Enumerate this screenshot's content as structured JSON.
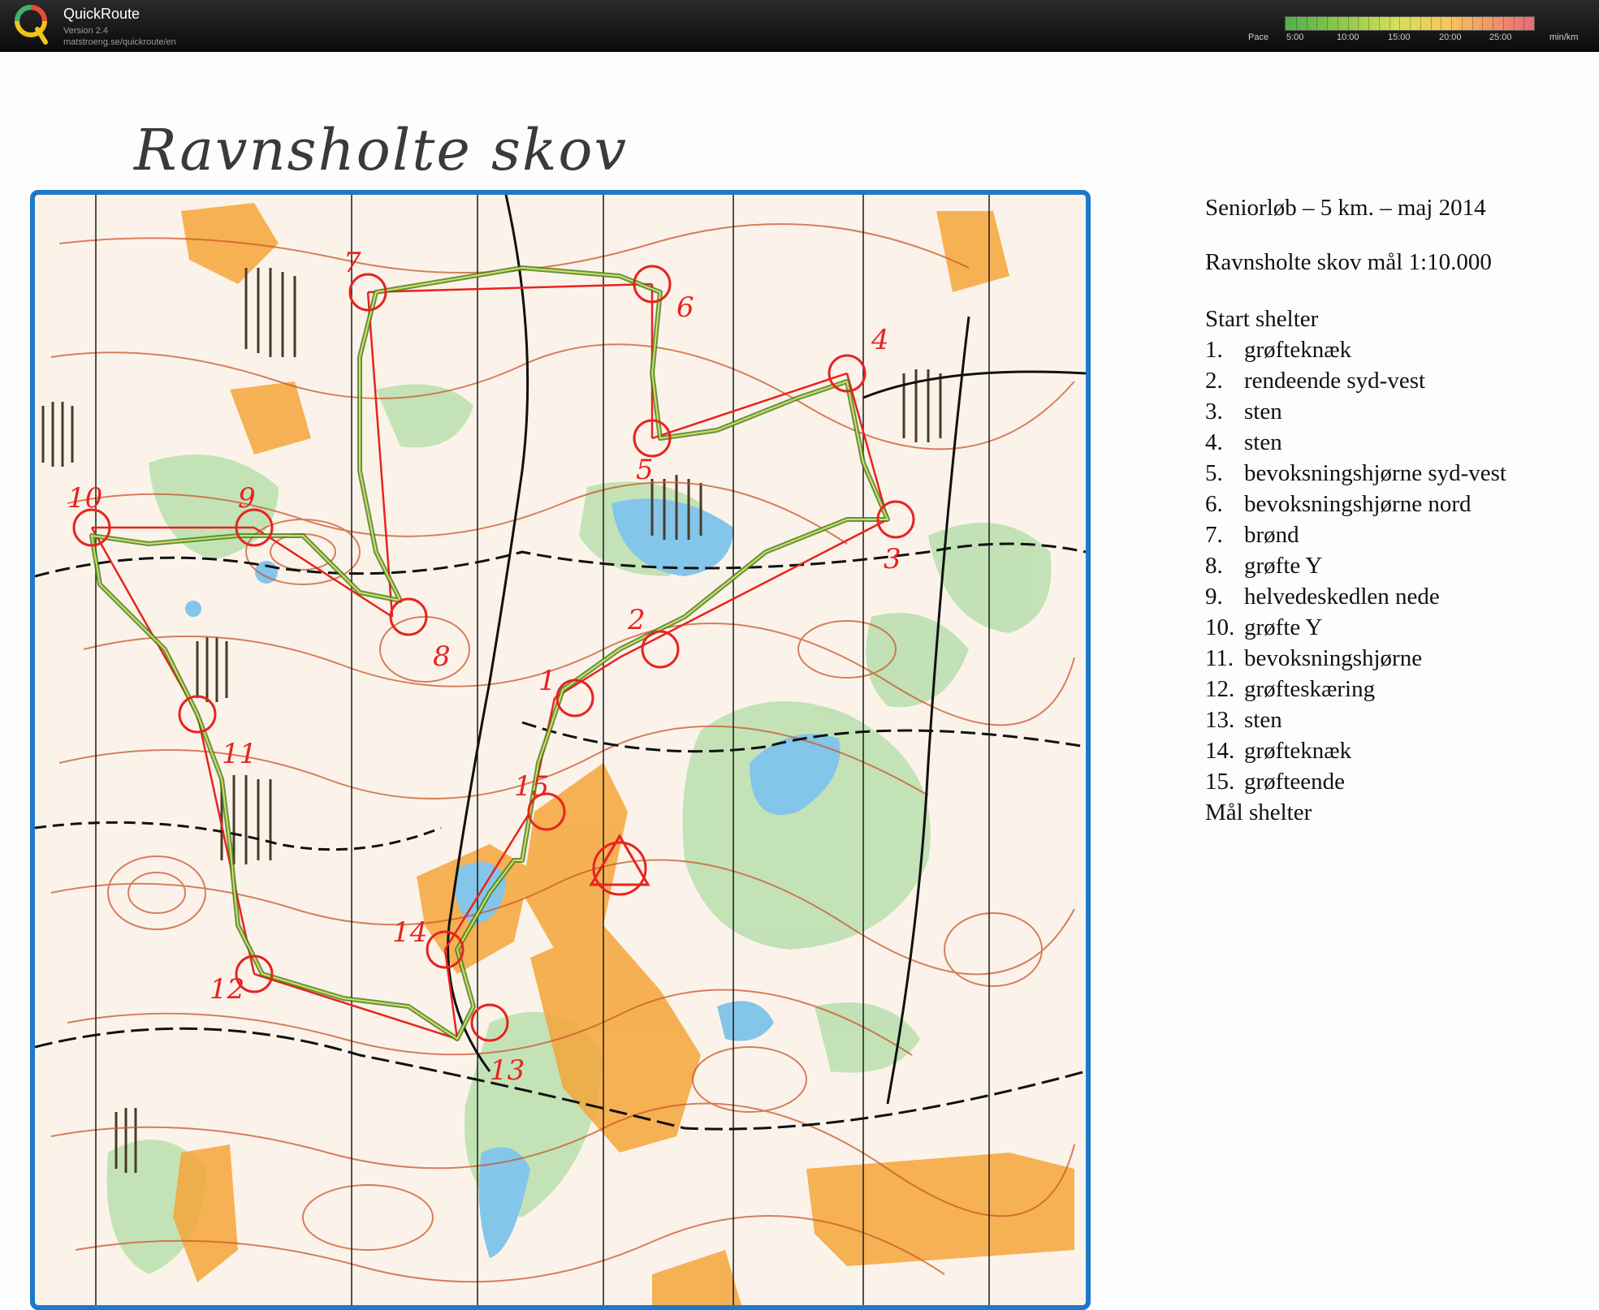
{
  "app": {
    "name": "QuickRoute",
    "version": "Version 2.4",
    "url": "matstroeng.se/quickroute/en"
  },
  "pace_legend": {
    "label": "Pace",
    "ticks": [
      "5:00",
      "10:00",
      "15:00",
      "20:00",
      "25:00"
    ],
    "unit": "min/km",
    "colors": [
      "#4fb04a",
      "#8cc84b",
      "#d7e05a",
      "#f5c75e",
      "#f0906a",
      "#e86a78"
    ]
  },
  "map": {
    "handwritten_title": "Ravnsholte skov",
    "frame_color": "#1c79c9",
    "control_color": "#e8231f",
    "route_color": "#5a8a2a",
    "controls": [
      {
        "label": "7"
      },
      {
        "label": "6"
      },
      {
        "label": "4"
      },
      {
        "label": "5"
      },
      {
        "label": "10"
      },
      {
        "label": "9"
      },
      {
        "label": "3"
      },
      {
        "label": "8"
      },
      {
        "label": "2"
      },
      {
        "label": "1"
      },
      {
        "label": "11"
      },
      {
        "label": "15"
      },
      {
        "label": "14"
      },
      {
        "label": "12"
      },
      {
        "label": "13"
      }
    ]
  },
  "course": {
    "title": "Seniorløb – 5 km. – maj 2014",
    "scale": "Ravnsholte skov mål 1:10.000",
    "start": "Start shelter",
    "descriptions": [
      {
        "num": "1.",
        "text": "grøfteknæk"
      },
      {
        "num": "2.",
        "text": "rendeende syd-vest"
      },
      {
        "num": "3.",
        "text": "sten"
      },
      {
        "num": "4.",
        "text": "sten"
      },
      {
        "num": "5.",
        "text": "bevoksningshjørne syd-vest"
      },
      {
        "num": "6.",
        "text": "bevoksningshjørne nord"
      },
      {
        "num": "7.",
        "text": "brønd"
      },
      {
        "num": "8.",
        "text": "grøfte Y"
      },
      {
        "num": "9.",
        "text": "helvedeskedlen nede"
      },
      {
        "num": "10.",
        "text": "grøfte Y"
      },
      {
        "num": "11.",
        "text": "bevoksningshjørne"
      },
      {
        "num": "12.",
        "text": "grøfteskæring"
      },
      {
        "num": "13.",
        "text": "sten"
      },
      {
        "num": "14.",
        "text": "grøfteknæk"
      },
      {
        "num": "15.",
        "text": "grøfteende"
      }
    ],
    "finish": "Mål shelter"
  }
}
